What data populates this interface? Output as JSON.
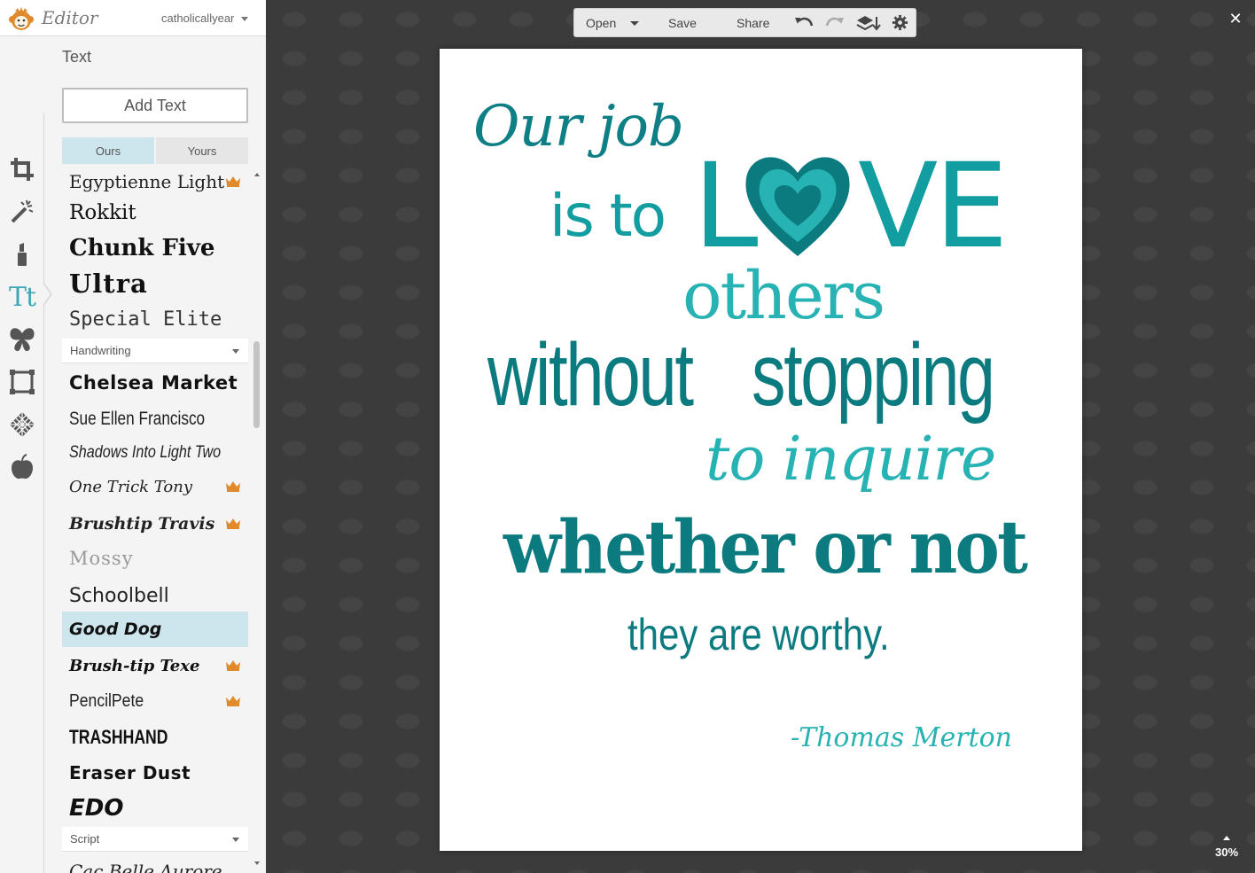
{
  "header": {
    "app_title": "Editor",
    "account": "catholicallyear"
  },
  "panel": {
    "title": "Text",
    "add_text_button": "Add Text",
    "tabs": [
      "Ours",
      "Yours"
    ],
    "categories": [
      "Handwriting",
      "Script"
    ],
    "fonts": [
      {
        "label": "Egyptienne Light",
        "premium": true
      },
      {
        "label": "Rokkit",
        "premium": false
      },
      {
        "label": "Chunk Five",
        "premium": false
      },
      {
        "label": "Ultra",
        "premium": false
      },
      {
        "label": "Special Elite",
        "premium": false
      },
      {
        "label": "Chelsea Market",
        "premium": false
      },
      {
        "label": "Sue Ellen Francisco",
        "premium": false
      },
      {
        "label": "Shadows Into Light Two",
        "premium": false
      },
      {
        "label": "One Trick Tony",
        "premium": true
      },
      {
        "label": "Brushtip Travis",
        "premium": true
      },
      {
        "label": "Mossy",
        "premium": false
      },
      {
        "label": "Schoolbell",
        "premium": false
      },
      {
        "label": "Good Dog",
        "premium": false,
        "selected": true
      },
      {
        "label": "Brush-tip Texe",
        "premium": true
      },
      {
        "label": "PencilPete",
        "premium": true
      },
      {
        "label": "TRASHHAND",
        "premium": false
      },
      {
        "label": "Eraser Dust",
        "premium": false
      },
      {
        "label": "EDO",
        "premium": false
      },
      {
        "label": "Cac Belle Aurore",
        "premium": false
      }
    ]
  },
  "toolbar": {
    "open": "Open",
    "save": "Save",
    "share": "Share"
  },
  "canvas": {
    "zoom": "30%",
    "quote": {
      "line1": "Our job",
      "line2a": "is to",
      "line2b_l": "L",
      "line2b_ve": "VE",
      "line3": "others",
      "line4a": "without",
      "line4b": "stopping",
      "line5": "to inquire",
      "line6": "whether or not",
      "line7": "they are worthy.",
      "attribution": "-Thomas Merton"
    }
  },
  "colors": {
    "teal_dark": "#0b7b80",
    "teal_mid": "#129ea1",
    "teal_light": "#27b2b3",
    "crown": "#e08a2b",
    "selection": "#cde6ee"
  }
}
